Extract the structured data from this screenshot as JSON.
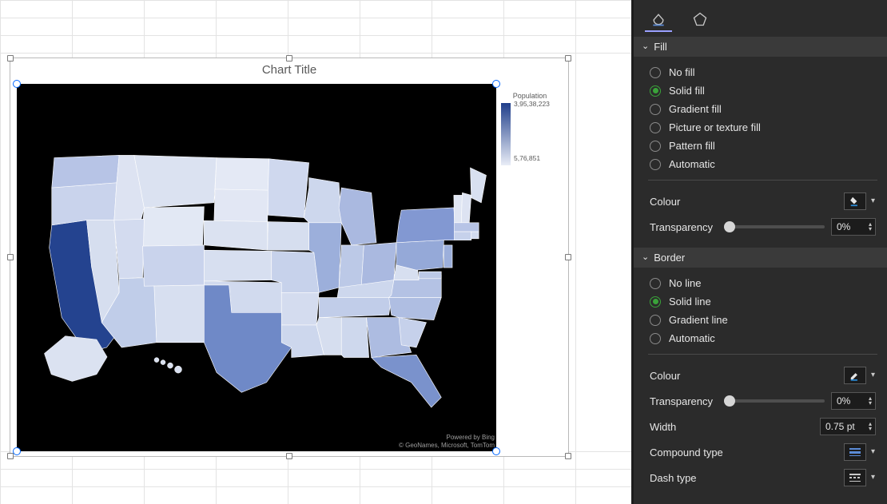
{
  "chart": {
    "title": "Chart Title",
    "legend_title": "Population",
    "legend_max": "3,95,38,223",
    "legend_min": "5,76,851",
    "attribution_line1": "Powered by Bing",
    "attribution_line2": "© GeoNames, Microsoft, TomTom"
  },
  "chart_data": {
    "type": "choropleth-map",
    "region": "United States",
    "metric": "Population",
    "scale": {
      "min": 576851,
      "max": 39538223,
      "colors": [
        "#e9edf7",
        "#1f3e8a"
      ]
    },
    "note": "Filled US map; California darkest (highest population), Texas & Florida medium-dark blue, NY/PA/IL mid-blue, most interior/plains states pale. Alaska & Hawaii shown pale.",
    "values_estimated_category": {
      "CA": "highest",
      "TX": "high",
      "FL": "high",
      "NY": "high",
      "PA": "mid",
      "IL": "mid",
      "OH": "mid",
      "GA": "mid",
      "NC": "mid",
      "MI": "mid",
      "NJ": "mid",
      "VA": "mid",
      "WA": "mid-low",
      "AZ": "mid-low",
      "TN": "mid-low",
      "IN": "mid-low",
      "MA": "mid-low",
      "most_others": "low"
    }
  },
  "pane": {
    "sections": {
      "fill": {
        "title": "Fill",
        "options": {
          "no_fill": "No fill",
          "solid_fill": "Solid fill",
          "gradient_fill": "Gradient fill",
          "picture_fill": "Picture or texture fill",
          "pattern_fill": "Pattern fill",
          "automatic": "Automatic"
        },
        "selected": "solid_fill",
        "colour_label": "Colour",
        "transparency_label": "Transparency",
        "transparency_value": "0%"
      },
      "border": {
        "title": "Border",
        "options": {
          "no_line": "No line",
          "solid_line": "Solid line",
          "gradient_line": "Gradient line",
          "automatic": "Automatic"
        },
        "selected": "solid_line",
        "colour_label": "Colour",
        "transparency_label": "Transparency",
        "transparency_value": "0%",
        "width_label": "Width",
        "width_value": "0.75 pt",
        "compound_label": "Compound type",
        "dash_label": "Dash type"
      }
    }
  }
}
